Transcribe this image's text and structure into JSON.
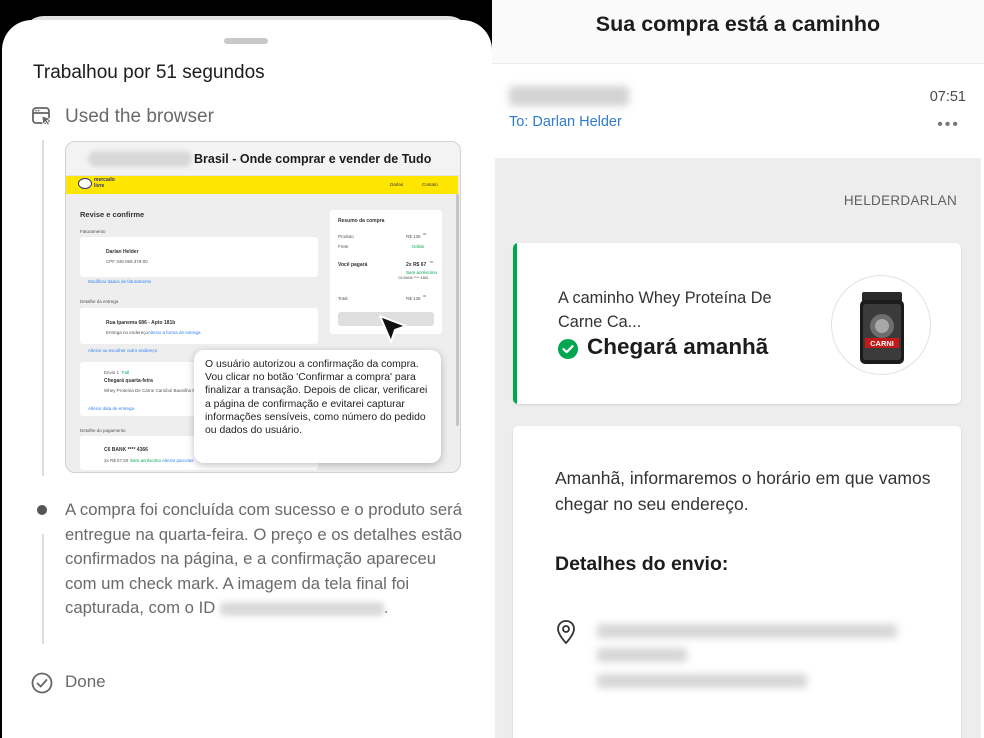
{
  "agent_panel": {
    "title": "Trabalhou por 51 segundos",
    "step_used": "Used the browser",
    "screenshot": {
      "tab_title": "Brasil - Onde comprar e vender de Tudo",
      "brand": "mercado livre",
      "user": "Darlan",
      "contact": "Contato",
      "page_title": "Revise e confirme",
      "billing_label": "Faturamento",
      "billing_name": "Darlan Helder",
      "billing_cpf": "CPF 348.059.378-00",
      "billing_link": "Modificar dados de faturamento",
      "delivery_label": "Detalhe da entrega",
      "delivery_address": "Rua Ipanema 686 - Apto 181b",
      "delivery_line": "Entrega no endereço",
      "delivery_line_link": "Alterar a forma de entrega",
      "delivery_link": "Alterar ou escolher outro endereço",
      "shipping_tag": "Envio 1",
      "shipping_tag2": "Full",
      "shipping_date": "Chegará quarta-feira",
      "shipping_product": "Whey Proteína De Carne Carnibol Baunilha 907g",
      "shipping_link": "Alterar data de entrega",
      "payment_label": "Detalhe do pagamento",
      "payment_bank": "C6 BANK **** 4366",
      "payment_value": "2x R$ 67,50",
      "payment_value_note": "Sem acréscimo",
      "payment_link": "Alterar parcelas",
      "summary_title": "Resumo da compra",
      "summary_product_label": "Produto",
      "summary_product_value": "R$ 135",
      "summary_product_cents": "00",
      "summary_shipping_label": "Frete",
      "summary_shipping_value": "Grátis",
      "summary_pay_label": "Você pagará",
      "summary_pay_value": "2x R$ 67",
      "summary_pay_cents": "50",
      "summary_pay_note": "Sem acréscimo",
      "summary_pay_card": "C6 BANK **** 4366",
      "summary_total_label": "Total",
      "summary_total_value": "R$ 135",
      "summary_total_cents": "00",
      "bubble_text": "O usuário autorizou a confirmação da compra. Vou clicar no botão 'Confirmar a compra' para finalizar a transação. Depois de clicar, verificarei a página de confirmação e evitarei capturar informações sensíveis, como número do pedido ou dados do usuário."
    },
    "result_text": "A compra foi concluída com sucesso e o produto será entregue na quarta-feira. O preço e os detalhes estão confirmados na página, e a confirmação apareceu com um check mark. A imagem da tela final foi capturada, com o ID",
    "result_end": ".",
    "done_label": "Done"
  },
  "email": {
    "title": "Sua compra está a caminho",
    "time": "07:51",
    "to": "To: Darlan Helder",
    "more": "•••",
    "recipient_tag": "HELDERDARLAN",
    "status_card": {
      "line": "A caminho Whey Proteína De Carne Ca...",
      "arrival": "Chegará amanhã",
      "product_label": "CARNI"
    },
    "info_card": {
      "message": "Amanhã, informaremos o horário em que vamos chegar no seu endereço.",
      "details_title": "Detalhes do envio:"
    }
  },
  "colors": {
    "accent_green": "#00a650",
    "link_blue": "#2f7bd3",
    "ml_yellow": "#ffe600"
  }
}
